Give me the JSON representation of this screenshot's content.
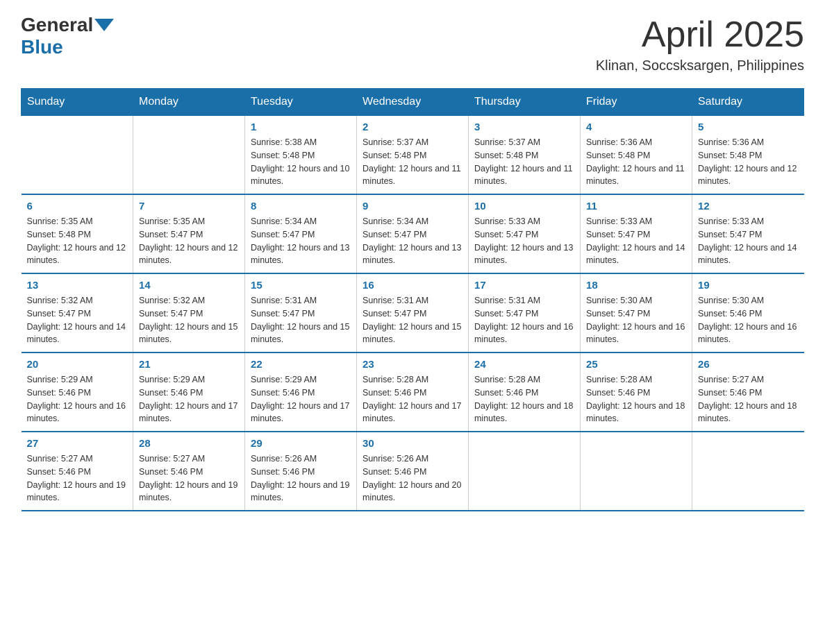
{
  "header": {
    "logo": {
      "general": "General",
      "blue": "Blue"
    },
    "title": "April 2025",
    "location": "Klinan, Soccsksargen, Philippines"
  },
  "days_of_week": [
    "Sunday",
    "Monday",
    "Tuesday",
    "Wednesday",
    "Thursday",
    "Friday",
    "Saturday"
  ],
  "weeks": [
    [
      {
        "day": "",
        "sunrise": "",
        "sunset": "",
        "daylight": ""
      },
      {
        "day": "",
        "sunrise": "",
        "sunset": "",
        "daylight": ""
      },
      {
        "day": "1",
        "sunrise": "Sunrise: 5:38 AM",
        "sunset": "Sunset: 5:48 PM",
        "daylight": "Daylight: 12 hours and 10 minutes."
      },
      {
        "day": "2",
        "sunrise": "Sunrise: 5:37 AM",
        "sunset": "Sunset: 5:48 PM",
        "daylight": "Daylight: 12 hours and 11 minutes."
      },
      {
        "day": "3",
        "sunrise": "Sunrise: 5:37 AM",
        "sunset": "Sunset: 5:48 PM",
        "daylight": "Daylight: 12 hours and 11 minutes."
      },
      {
        "day": "4",
        "sunrise": "Sunrise: 5:36 AM",
        "sunset": "Sunset: 5:48 PM",
        "daylight": "Daylight: 12 hours and 11 minutes."
      },
      {
        "day": "5",
        "sunrise": "Sunrise: 5:36 AM",
        "sunset": "Sunset: 5:48 PM",
        "daylight": "Daylight: 12 hours and 12 minutes."
      }
    ],
    [
      {
        "day": "6",
        "sunrise": "Sunrise: 5:35 AM",
        "sunset": "Sunset: 5:48 PM",
        "daylight": "Daylight: 12 hours and 12 minutes."
      },
      {
        "day": "7",
        "sunrise": "Sunrise: 5:35 AM",
        "sunset": "Sunset: 5:47 PM",
        "daylight": "Daylight: 12 hours and 12 minutes."
      },
      {
        "day": "8",
        "sunrise": "Sunrise: 5:34 AM",
        "sunset": "Sunset: 5:47 PM",
        "daylight": "Daylight: 12 hours and 13 minutes."
      },
      {
        "day": "9",
        "sunrise": "Sunrise: 5:34 AM",
        "sunset": "Sunset: 5:47 PM",
        "daylight": "Daylight: 12 hours and 13 minutes."
      },
      {
        "day": "10",
        "sunrise": "Sunrise: 5:33 AM",
        "sunset": "Sunset: 5:47 PM",
        "daylight": "Daylight: 12 hours and 13 minutes."
      },
      {
        "day": "11",
        "sunrise": "Sunrise: 5:33 AM",
        "sunset": "Sunset: 5:47 PM",
        "daylight": "Daylight: 12 hours and 14 minutes."
      },
      {
        "day": "12",
        "sunrise": "Sunrise: 5:33 AM",
        "sunset": "Sunset: 5:47 PM",
        "daylight": "Daylight: 12 hours and 14 minutes."
      }
    ],
    [
      {
        "day": "13",
        "sunrise": "Sunrise: 5:32 AM",
        "sunset": "Sunset: 5:47 PM",
        "daylight": "Daylight: 12 hours and 14 minutes."
      },
      {
        "day": "14",
        "sunrise": "Sunrise: 5:32 AM",
        "sunset": "Sunset: 5:47 PM",
        "daylight": "Daylight: 12 hours and 15 minutes."
      },
      {
        "day": "15",
        "sunrise": "Sunrise: 5:31 AM",
        "sunset": "Sunset: 5:47 PM",
        "daylight": "Daylight: 12 hours and 15 minutes."
      },
      {
        "day": "16",
        "sunrise": "Sunrise: 5:31 AM",
        "sunset": "Sunset: 5:47 PM",
        "daylight": "Daylight: 12 hours and 15 minutes."
      },
      {
        "day": "17",
        "sunrise": "Sunrise: 5:31 AM",
        "sunset": "Sunset: 5:47 PM",
        "daylight": "Daylight: 12 hours and 16 minutes."
      },
      {
        "day": "18",
        "sunrise": "Sunrise: 5:30 AM",
        "sunset": "Sunset: 5:47 PM",
        "daylight": "Daylight: 12 hours and 16 minutes."
      },
      {
        "day": "19",
        "sunrise": "Sunrise: 5:30 AM",
        "sunset": "Sunset: 5:46 PM",
        "daylight": "Daylight: 12 hours and 16 minutes."
      }
    ],
    [
      {
        "day": "20",
        "sunrise": "Sunrise: 5:29 AM",
        "sunset": "Sunset: 5:46 PM",
        "daylight": "Daylight: 12 hours and 16 minutes."
      },
      {
        "day": "21",
        "sunrise": "Sunrise: 5:29 AM",
        "sunset": "Sunset: 5:46 PM",
        "daylight": "Daylight: 12 hours and 17 minutes."
      },
      {
        "day": "22",
        "sunrise": "Sunrise: 5:29 AM",
        "sunset": "Sunset: 5:46 PM",
        "daylight": "Daylight: 12 hours and 17 minutes."
      },
      {
        "day": "23",
        "sunrise": "Sunrise: 5:28 AM",
        "sunset": "Sunset: 5:46 PM",
        "daylight": "Daylight: 12 hours and 17 minutes."
      },
      {
        "day": "24",
        "sunrise": "Sunrise: 5:28 AM",
        "sunset": "Sunset: 5:46 PM",
        "daylight": "Daylight: 12 hours and 18 minutes."
      },
      {
        "day": "25",
        "sunrise": "Sunrise: 5:28 AM",
        "sunset": "Sunset: 5:46 PM",
        "daylight": "Daylight: 12 hours and 18 minutes."
      },
      {
        "day": "26",
        "sunrise": "Sunrise: 5:27 AM",
        "sunset": "Sunset: 5:46 PM",
        "daylight": "Daylight: 12 hours and 18 minutes."
      }
    ],
    [
      {
        "day": "27",
        "sunrise": "Sunrise: 5:27 AM",
        "sunset": "Sunset: 5:46 PM",
        "daylight": "Daylight: 12 hours and 19 minutes."
      },
      {
        "day": "28",
        "sunrise": "Sunrise: 5:27 AM",
        "sunset": "Sunset: 5:46 PM",
        "daylight": "Daylight: 12 hours and 19 minutes."
      },
      {
        "day": "29",
        "sunrise": "Sunrise: 5:26 AM",
        "sunset": "Sunset: 5:46 PM",
        "daylight": "Daylight: 12 hours and 19 minutes."
      },
      {
        "day": "30",
        "sunrise": "Sunrise: 5:26 AM",
        "sunset": "Sunset: 5:46 PM",
        "daylight": "Daylight: 12 hours and 20 minutes."
      },
      {
        "day": "",
        "sunrise": "",
        "sunset": "",
        "daylight": ""
      },
      {
        "day": "",
        "sunrise": "",
        "sunset": "",
        "daylight": ""
      },
      {
        "day": "",
        "sunrise": "",
        "sunset": "",
        "daylight": ""
      }
    ]
  ]
}
